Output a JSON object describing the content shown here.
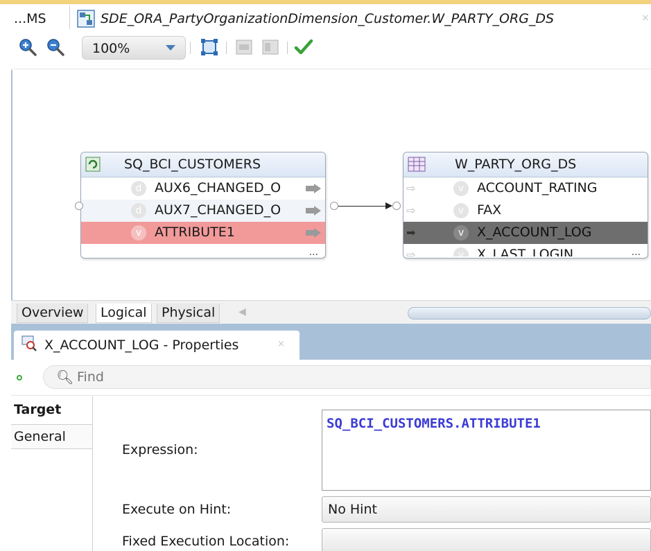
{
  "tabs": {
    "ms_label": "...MS",
    "doc_title": "SDE_ORA_PartyOrganizationDimension_Customer.W_PARTY_ORG_DS",
    "close_glyph": "×"
  },
  "toolbar": {
    "zoom_in_icon": "zoom-in-icon",
    "zoom_out_icon": "zoom-out-icon",
    "zoom_value": "100%",
    "fit_icon": "fit-to-window-icon",
    "validate_icon": "checkmark-icon"
  },
  "diagram": {
    "source": {
      "title": "SQ_BCI_CUSTOMERS",
      "rows": [
        {
          "badge": "d",
          "label": "AUX6_CHANGED_O"
        },
        {
          "badge": "d",
          "label": "AUX7_CHANGED_O"
        },
        {
          "badge": "v",
          "label": "ATTRIBUTE1"
        }
      ],
      "more": "..."
    },
    "target": {
      "title": "W_PARTY_ORG_DS",
      "rows": [
        {
          "badge": "v",
          "label": "ACCOUNT_RATING"
        },
        {
          "badge": "v",
          "label": "FAX"
        },
        {
          "badge": "v",
          "label": "X_ACCOUNT_LOG"
        },
        {
          "badge": "v",
          "label": "X_LAST_LOGIN"
        }
      ],
      "more": "..."
    },
    "colors": {
      "highlight": "#f29a9a",
      "selected": "#6e6e6e"
    }
  },
  "diagram_tabs": {
    "overview": "Overview",
    "logical": "Logical",
    "physical": "Physical"
  },
  "properties": {
    "title": "X_ACCOUNT_LOG - Properties",
    "find_placeholder": "Find",
    "nav": {
      "target": "Target",
      "general": "General"
    },
    "expression_label": "Expression:",
    "expression_value": "SQ_BCI_CUSTOMERS.ATTRIBUTE1",
    "hint_label": "Execute on Hint:",
    "hint_value": "No Hint",
    "location_label": "Fixed Execution Location:",
    "location_value": ""
  }
}
